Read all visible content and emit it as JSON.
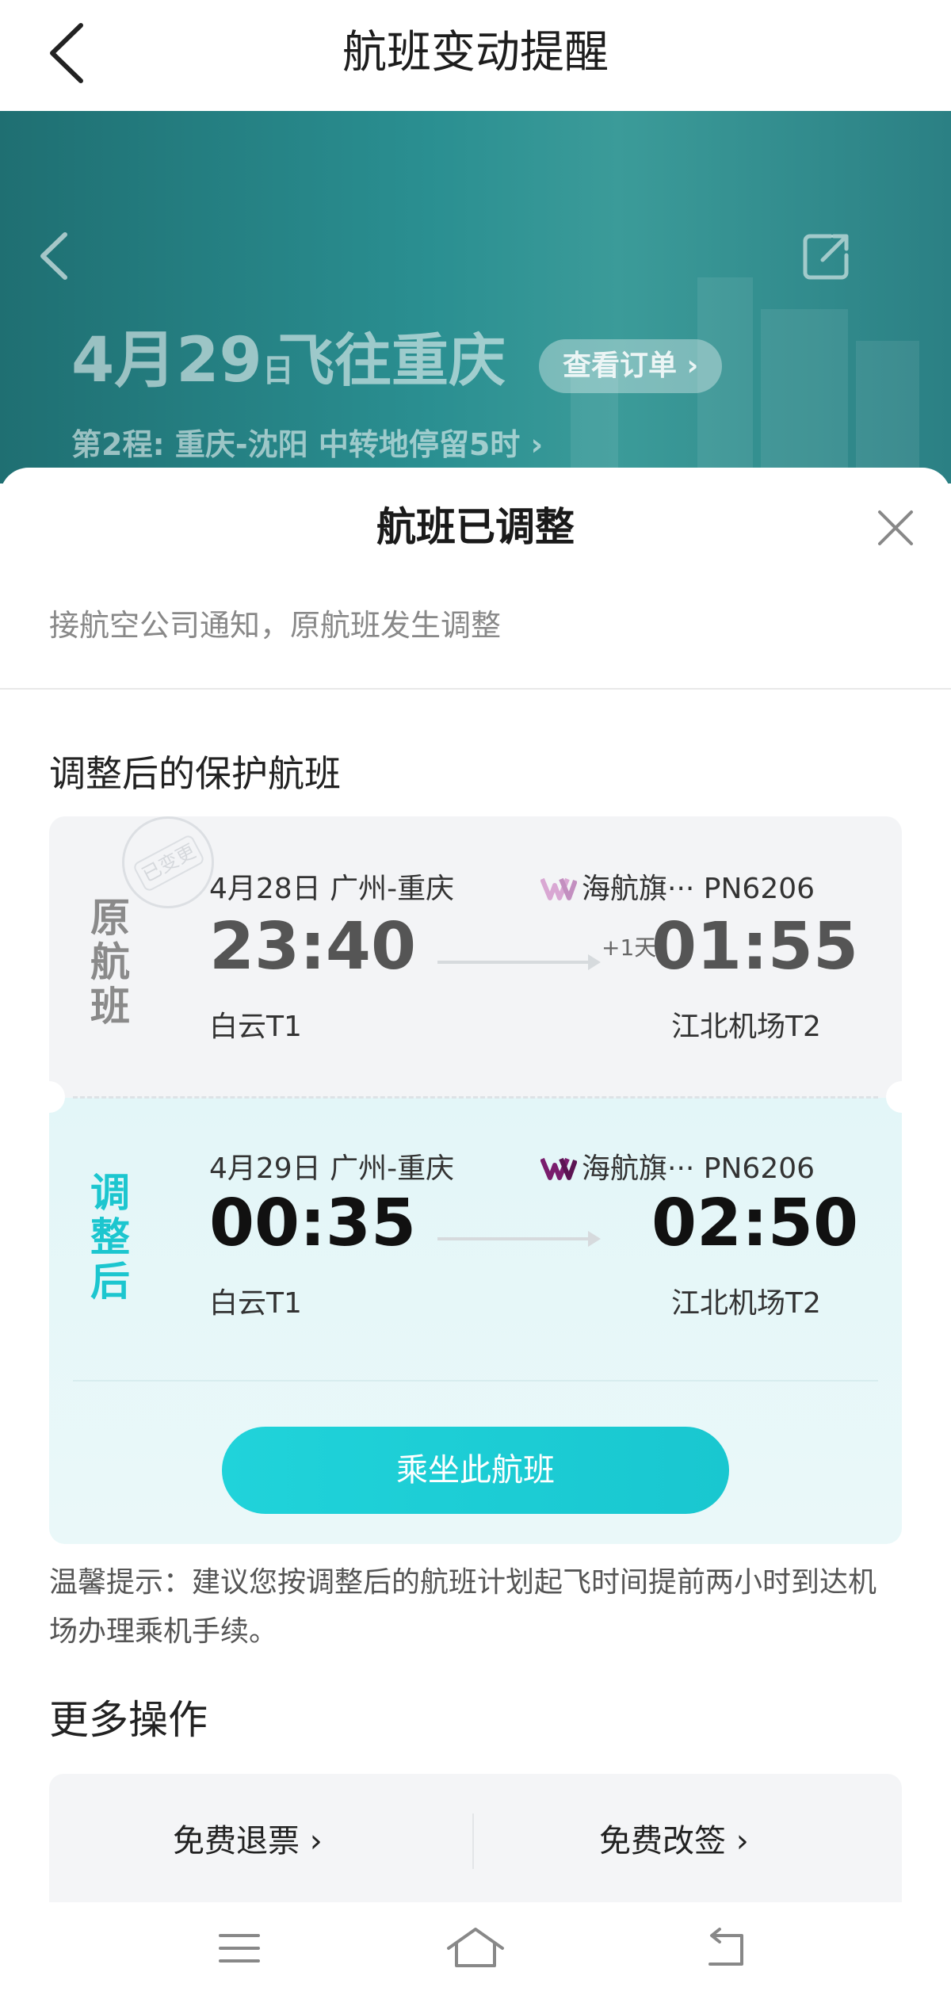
{
  "header": {
    "title": "航班变动提醒"
  },
  "hero": {
    "date_day": "4月29",
    "date_unit": "日",
    "destination": "飞往重庆",
    "order_button": "查看订单 ›",
    "leg_info": "第2程: 重庆-沈阳 中转地停留5时 ›"
  },
  "sheet": {
    "title": "航班已调整",
    "subtitle": "接航空公司通知，原航班发生调整",
    "section_title": "调整后的保护航班"
  },
  "original_flight": {
    "label": [
      "原",
      "航",
      "班"
    ],
    "stamp_text": "已变更",
    "date_route": "4月28日  广州-重庆",
    "airline": "海航旗··· PN6206",
    "dep_time": "23:40",
    "arr_time": "01:55",
    "plus_day": "+1天",
    "dep_airport": "白云T1",
    "arr_airport": "江北机场T2"
  },
  "new_flight": {
    "label": [
      "调",
      "整",
      "后"
    ],
    "date_route": "4月29日  广州-重庆",
    "airline": "海航旗··· PN6206",
    "dep_time": "00:35",
    "arr_time": "02:50",
    "dep_airport": "白云T1",
    "arr_airport": "江北机场T2"
  },
  "actions": {
    "choose_flight": "乘坐此航班",
    "tip": "温馨提示：建议您按调整后的航班计划起飞时间提前两小时到达机场办理乘机手续。",
    "more_title": "更多操作",
    "refund": "免费退票 ›",
    "change": "免费改签 ›"
  },
  "colors": {
    "accent": "#1ccbd3",
    "hero_teal": "#2a8f91",
    "label_original": "#8a8a8a",
    "label_new": "#1cc6cf"
  }
}
